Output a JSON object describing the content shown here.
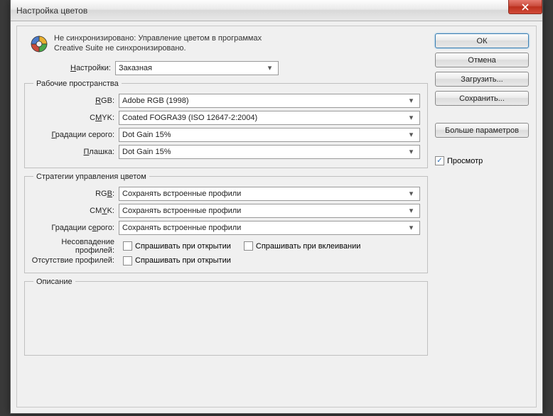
{
  "window_title": "Настройка цветов",
  "sync_message": "Не синхронизировано: Управление цветом в программах Creative Suite не синхронизировано.",
  "settings": {
    "label": "Настройки:",
    "value": "Заказная"
  },
  "working_spaces": {
    "legend": "Рабочие пространства",
    "rgb": {
      "label": "RGB:",
      "value": "Adobe RGB (1998)"
    },
    "cmyk": {
      "label": "CMYK:",
      "value": "Coated FOGRA39 (ISO 12647-2:2004)"
    },
    "gray": {
      "label": "Градации серого:",
      "value": "Dot Gain 15%"
    },
    "spot": {
      "label": "Плашка:",
      "value": "Dot Gain 15%"
    }
  },
  "policies": {
    "legend": "Стратегии управления цветом",
    "rgb": {
      "label": "RGB:",
      "value": "Сохранять встроенные профили"
    },
    "cmyk": {
      "label": "CMYK:",
      "value": "Сохранять встроенные профили"
    },
    "gray": {
      "label": "Градации серого:",
      "value": "Сохранять встроенные профили"
    },
    "mismatch_label": "Несовпадение профилей:",
    "missing_label": "Отсутствие профилей:",
    "ask_open": "Спрашивать при открытии",
    "ask_paste": "Спрашивать при вклеивании"
  },
  "description": {
    "legend": "Описание"
  },
  "buttons": {
    "ok": "ОК",
    "cancel": "Отмена",
    "load": "Загрузить...",
    "save": "Сохранить...",
    "more": "Больше параметров",
    "preview": "Просмотр"
  }
}
